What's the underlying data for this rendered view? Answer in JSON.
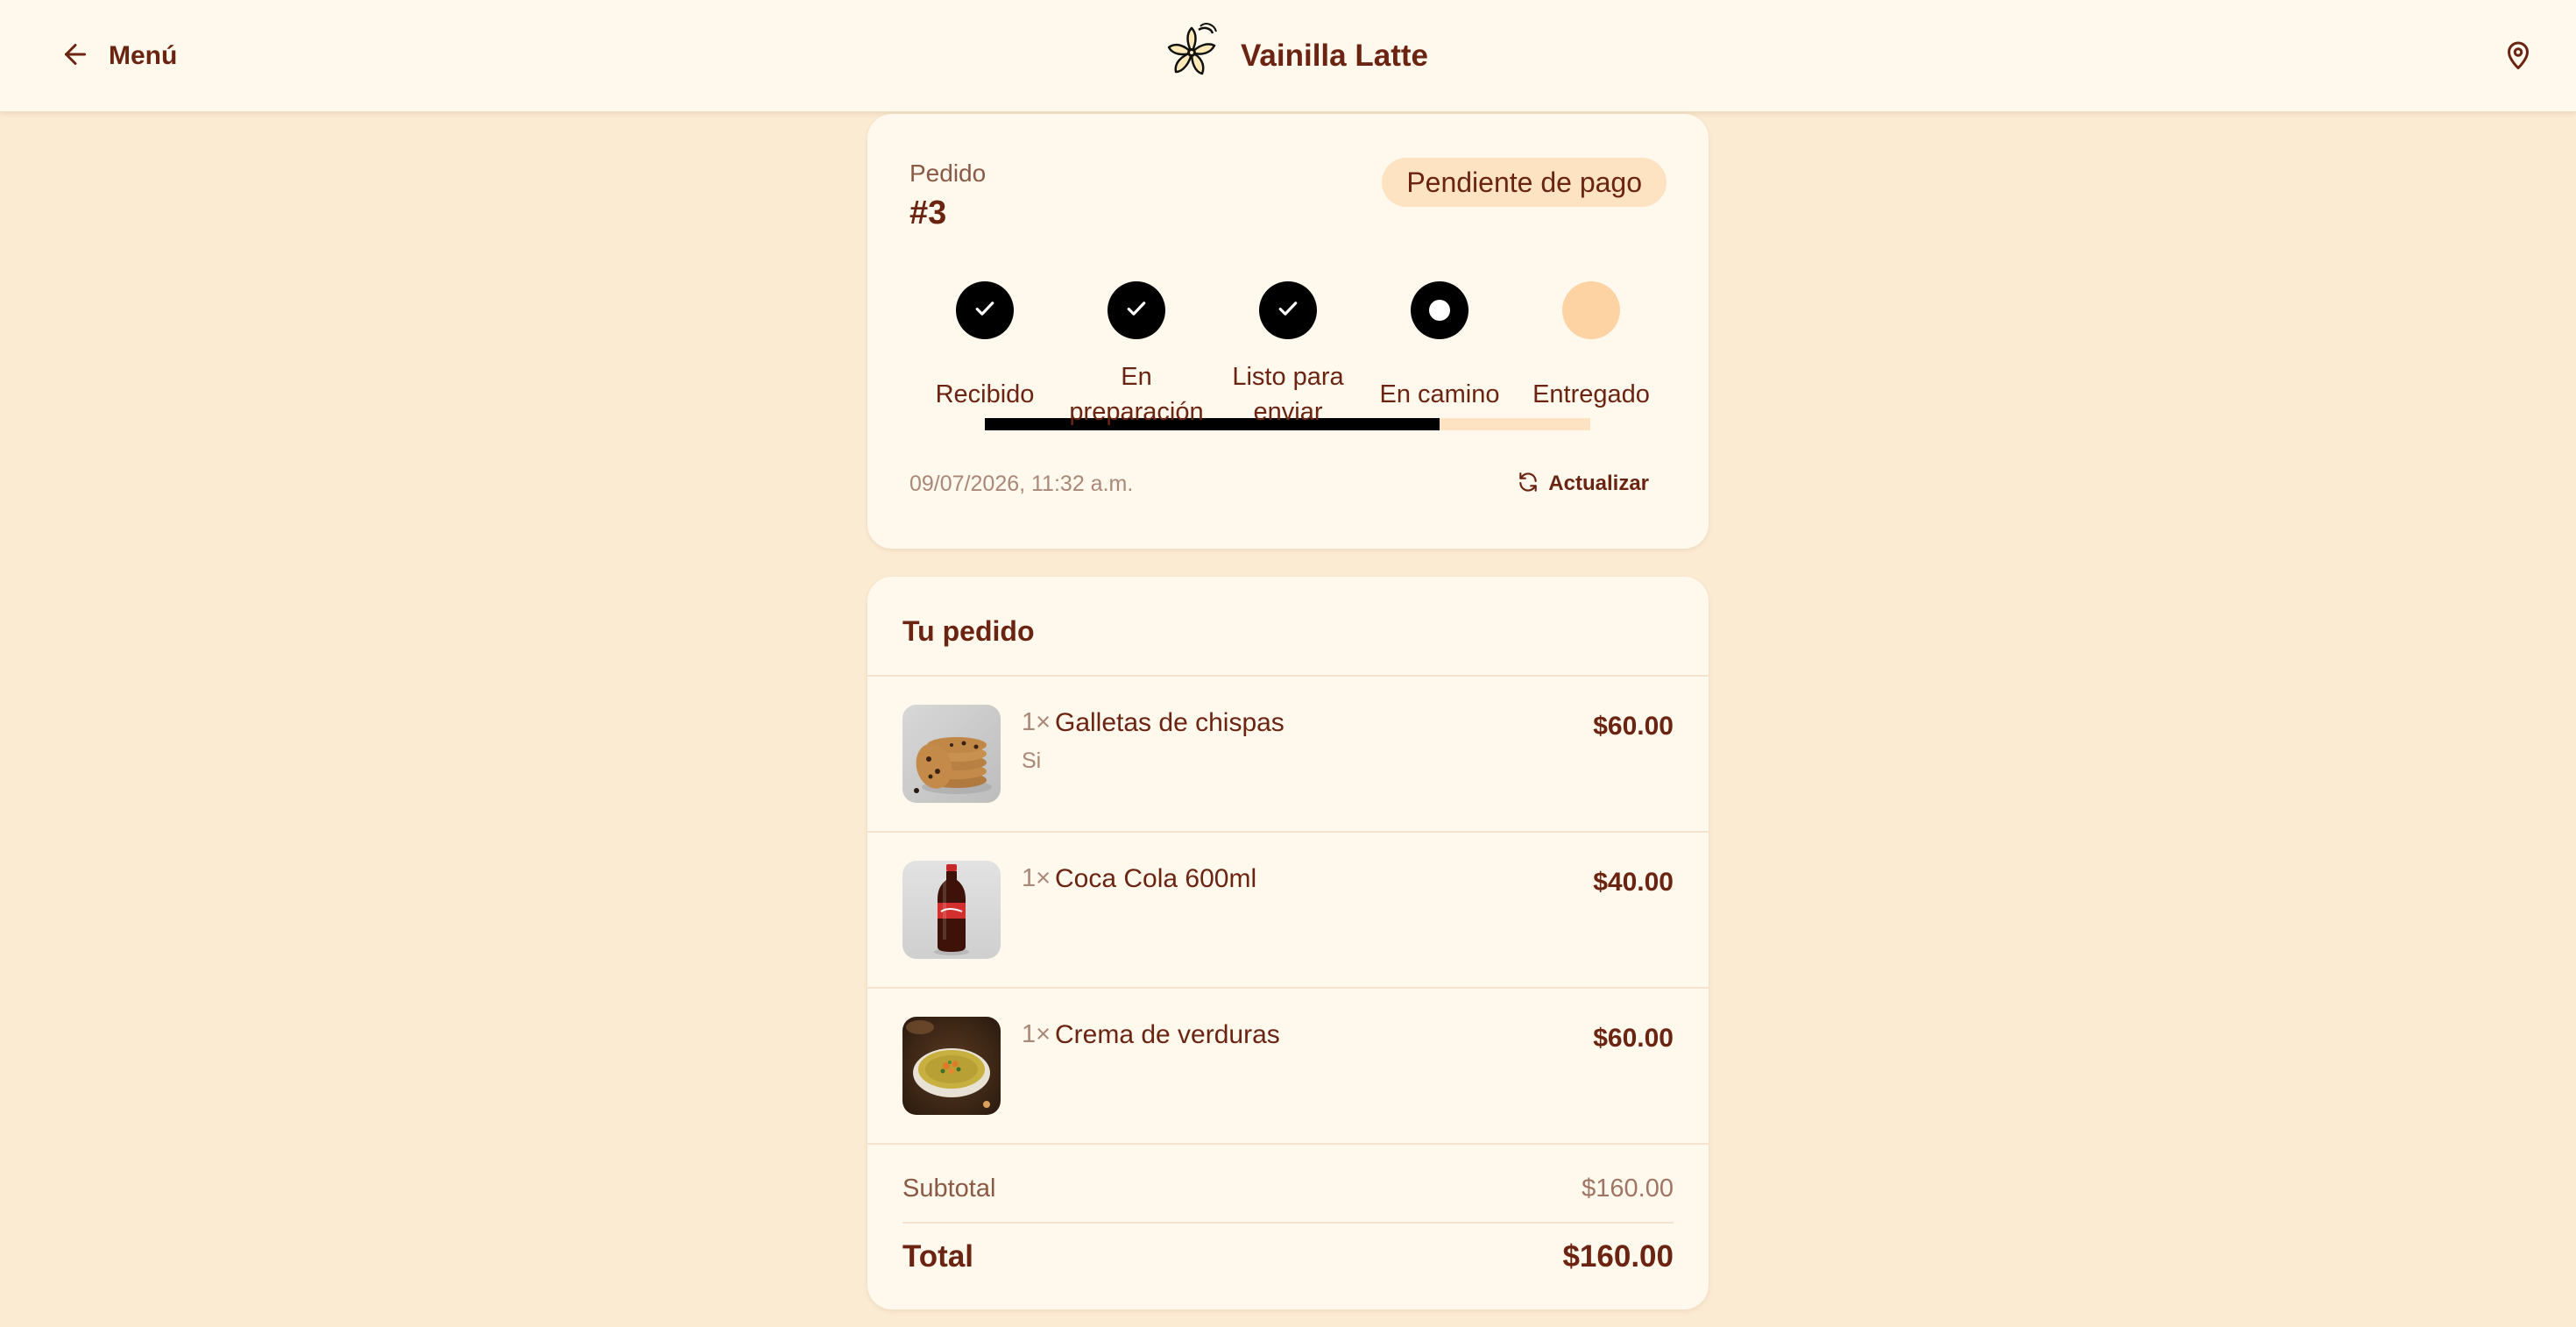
{
  "header": {
    "back_label": "Menú",
    "brand_name": "Vainilla Latte"
  },
  "order": {
    "label": "Pedido",
    "number": "#3",
    "status_badge": "Pendiente de pago",
    "steps": [
      {
        "label": "Recibido",
        "state": "done"
      },
      {
        "label": "En preparación",
        "state": "done"
      },
      {
        "label": "Listo para enviar",
        "state": "done"
      },
      {
        "label": "En camino",
        "state": "current"
      },
      {
        "label": "Entregado",
        "state": "pending"
      }
    ],
    "timestamp": "09/07/2026, 11:32 a.m.",
    "refresh_label": "Actualizar"
  },
  "summary": {
    "title": "Tu pedido",
    "items": [
      {
        "qty": "1×",
        "name": "Galletas de chispas",
        "note": "Si",
        "price": "$60.00",
        "image": "cookies-image"
      },
      {
        "qty": "1×",
        "name": "Coca Cola 600ml",
        "note": "",
        "price": "$40.00",
        "image": "cola-bottle-image"
      },
      {
        "qty": "1×",
        "name": "Crema de verduras",
        "note": "",
        "price": "$60.00",
        "image": "soup-bowl-image"
      }
    ],
    "subtotal_label": "Subtotal",
    "subtotal_value": "$160.00",
    "total_label": "Total",
    "total_value": "$160.00"
  },
  "colors": {
    "background": "#fcebd3",
    "card": "#fff8ec",
    "text": "#6b2412",
    "badge": "#fde3c2",
    "step_done": "#000000",
    "step_pending": "#fdd3a4"
  },
  "icons": [
    "arrow-left-icon",
    "vanilla-flower-logo",
    "map-pin-icon",
    "check-icon",
    "refresh-icon"
  ]
}
